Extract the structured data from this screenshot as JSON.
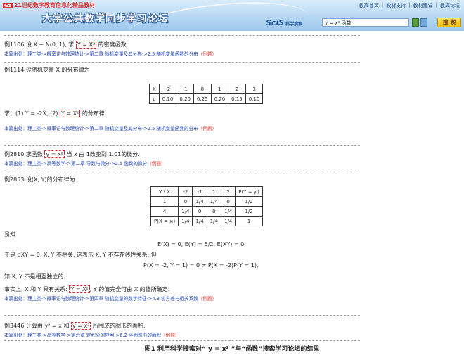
{
  "header": {
    "brand": "21世纪数字教育信息化精品教材",
    "brand_mark": "Gz",
    "title": "大学公共数学同步学习论坛",
    "nav": [
      "教高首页",
      "教材支持",
      "教材建设",
      "教高论坛"
    ],
    "scis_logo": "SciS",
    "scis_sub": "科学搜索",
    "search_value": "y = x²  函数",
    "search_button": "搜 索"
  },
  "entries": [
    {
      "q": "例1106 设 X ~ N(0, 1), 求 ",
      "hl": "Y = X²",
      "tail": " 的密度函数.",
      "src": "本篇出处：理工类->概率论与数理统计->第二章 随机变量及其分布->2.5 随机变量函数的分布",
      "ex": "（例题）"
    },
    {
      "q": "例1114 设随机变量 X 的分布律为",
      "table": [
        [
          "X",
          "-2",
          "-1",
          "0",
          "1",
          "2",
          "3"
        ],
        [
          "p",
          "0.10",
          "0.20",
          "0.25",
          "0.20",
          "0.15",
          "0.10"
        ]
      ],
      "ask": "求：(1) Y = -2X,    (2) ",
      "hl": "Y = X²",
      "tail": " 的分布律.",
      "src": "本篇出处：理工类->概率论与数理统计->第二章 随机变量及其分布->2.5 随机变量函数的分布",
      "ex": "（例题）"
    },
    {
      "q": "例2810 求函数 ",
      "hl": "y = x²",
      "tail": " 当 x 由 1改变到 1.01的微分.",
      "src": "本篇出处：理工类->高等数学->第二章 导数与微分->2.5 函数的微分",
      "ex": "（例题）"
    },
    {
      "q": "例2853 设(X, Y)的分布律为",
      "table": [
        [
          "Y \\ X",
          "-2",
          "-1",
          "1",
          "2",
          "P(Y = yⱼ)"
        ],
        [
          "1",
          "0",
          "1/4",
          "1/4",
          "0",
          "1/2"
        ],
        [
          "4",
          "1/4",
          "0",
          "0",
          "1/4",
          "1/2"
        ],
        [
          "P(X = xᵢ)",
          "1/4",
          "1/4",
          "1/4",
          "1/4",
          "1"
        ]
      ],
      "easy": "易知",
      "eq1": "E(X) = 0,  E(Y) = 5/2,  E(XY) = 0,",
      "line2": "于是 ρXY = 0,  X, Y 不相关, 这表示 X, Y 不存在线性关系, 但",
      "eq2": "P(X = -2, Y = 1) = 0 ≠ P(X = -2)P(Y = 1),",
      "line3": "知 X, Y 不是相互独立的.",
      "line4a": "事实上, X 和 Y 具有关系: ",
      "hl": "Y = X²",
      "line4b": ", Y 的值完全可由 X 的值所确定.",
      "src": "本篇出处：理工类->概率论与数理统计->第四章 随机变量的数字特征->4.3 协方差与相关系数",
      "ex": "（例题）"
    },
    {
      "q": "例3446 计算由 y² = x 和 ",
      "hl": "y = x²",
      "tail": " 所围成的图形的面积.",
      "src": "本篇出处：理工类->高等数学->第六章 定积分的应用->6.2 平面图形的面积",
      "ex": "（例题）"
    }
  ],
  "caption": "图1  利用科学搜索对“ y = x² ”与“函数”搜索学习论坛的结果"
}
